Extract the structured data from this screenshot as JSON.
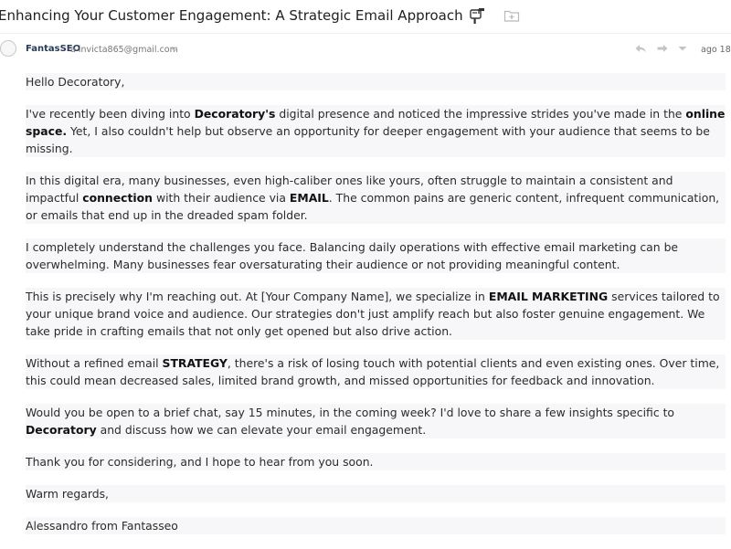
{
  "email": {
    "subject": "Enhancing Your Customer Engagement: A Strategic Email Approach",
    "subject_icon": "mailbox-icon",
    "sender_name": "FantasSEO",
    "recipient": "a invicta865@gmail.com",
    "date": "ago 18",
    "actions": [
      "reply-icon",
      "forward-icon",
      "more-chevron-icon"
    ]
  },
  "body": {
    "p1": "Hello Decoratory,",
    "p2": {
      "t1": "I've recently been diving into ",
      "b1": "Decoratory's",
      "t2": " digital presence and noticed the impressive strides you've made in the ",
      "b2": "online space.",
      "t3": " Yet, I also couldn't help but observe an opportunity for deeper engagement with your audience that seems to be missing."
    },
    "p3": {
      "t1": "In this digital era, many businesses, even high-caliber ones like yours, often struggle to maintain a consistent and impactful ",
      "b1": "connection",
      "t2": " with their audience via ",
      "b2": "EMAIL",
      "t3": ". The common pains are generic content, infrequent communication, or emails that end up in the dreaded spam folder."
    },
    "p4": "I completely understand the challenges you face. Balancing daily operations with effective email marketing can be overwhelming. Many businesses fear oversaturating their audience or not providing meaningful content.",
    "p5": {
      "t1": "This is precisely why I'm reaching out. At [Your Company Name], we specialize in ",
      "b1": "EMAIL MARKETING",
      "t2": " services tailored to your unique brand voice and audience. Our strategies don't just amplify reach but also foster genuine engagement. We take pride in crafting emails that not only get opened but also drive action."
    },
    "p6": {
      "t1": "Without a refined email ",
      "b1": "STRATEGY",
      "t2": ", there's a risk of losing touch with potential clients and even existing ones. Over time, this could mean decreased sales, limited brand growth, and missed opportunities for feedback and innovation."
    },
    "p7": {
      "t1": "Would you be open to a brief chat, say 15 minutes, in the coming week? I'd love to share a few insights specific to ",
      "b1": "Decoratory",
      "t2": " and discuss how we can elevate your email engagement."
    },
    "p8": "Thank you for considering, and I hope to hear from you soon.",
    "p9": "Warm regards,",
    "p10": "Alessandro from Fantasseo"
  }
}
